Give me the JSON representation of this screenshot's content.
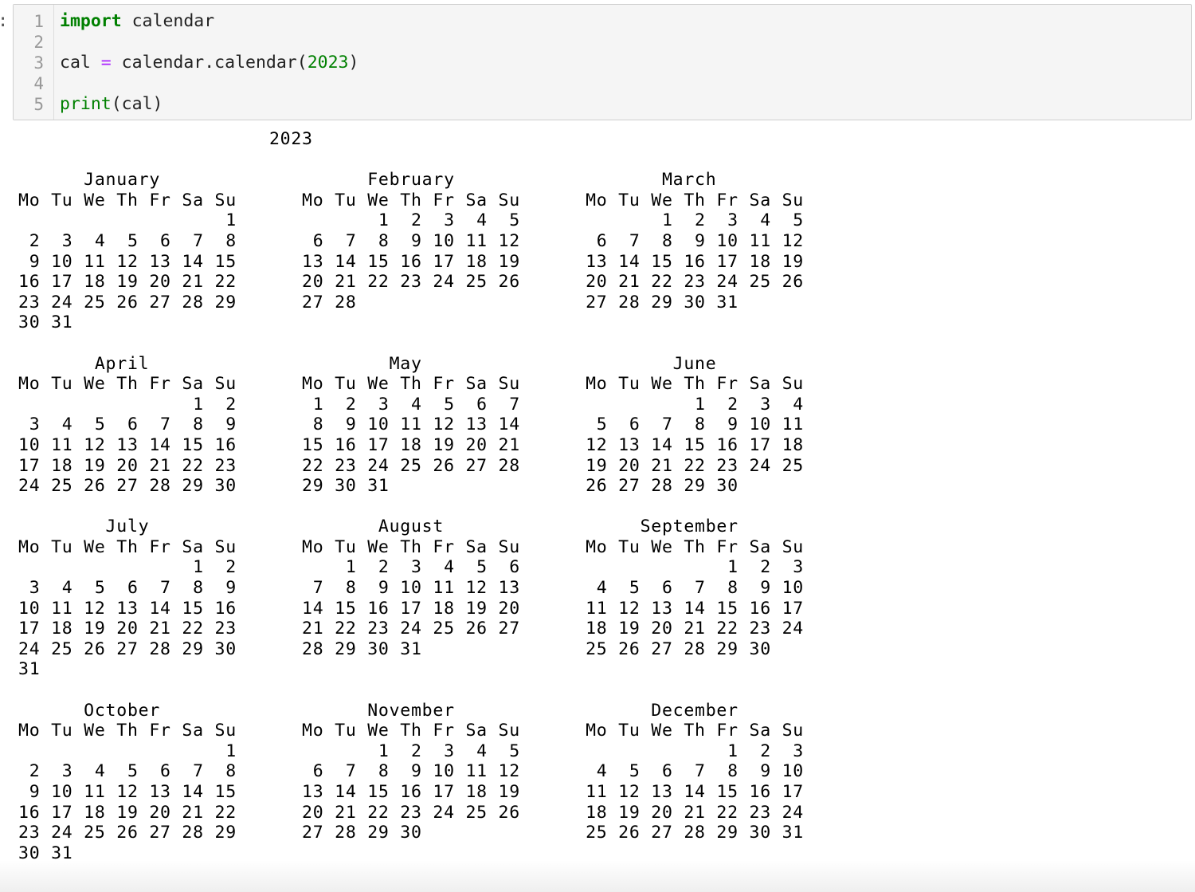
{
  "cell": {
    "prompt": ":",
    "line_numbers": [
      "1",
      "2",
      "3",
      "4",
      "5"
    ],
    "code": {
      "line1_keyword": "import",
      "line1_rest": " calendar",
      "line3_prefix": "cal ",
      "line3_op": "=",
      "line3_call": " calendar.calendar(",
      "line3_arg": "2023",
      "line3_close": ")",
      "line5_builtin": "print",
      "line5_rest": "(cal)"
    }
  },
  "output": {
    "text": "                       2023\n\n      January                   February                   March\nMo Tu We Th Fr Sa Su      Mo Tu We Th Fr Sa Su      Mo Tu We Th Fr Sa Su\n                   1             1  2  3  4  5             1  2  3  4  5\n 2  3  4  5  6  7  8       6  7  8  9 10 11 12       6  7  8  9 10 11 12\n 9 10 11 12 13 14 15      13 14 15 16 17 18 19      13 14 15 16 17 18 19\n16 17 18 19 20 21 22      20 21 22 23 24 25 26      20 21 22 23 24 25 26\n23 24 25 26 27 28 29      27 28                     27 28 29 30 31\n30 31\n\n       April                      May                       June\nMo Tu We Th Fr Sa Su      Mo Tu We Th Fr Sa Su      Mo Tu We Th Fr Sa Su\n                1  2       1  2  3  4  5  6  7                1  2  3  4\n 3  4  5  6  7  8  9       8  9 10 11 12 13 14       5  6  7  8  9 10 11\n10 11 12 13 14 15 16      15 16 17 18 19 20 21      12 13 14 15 16 17 18\n17 18 19 20 21 22 23      22 23 24 25 26 27 28      19 20 21 22 23 24 25\n24 25 26 27 28 29 30      29 30 31                  26 27 28 29 30\n\n        July                     August                  September\nMo Tu We Th Fr Sa Su      Mo Tu We Th Fr Sa Su      Mo Tu We Th Fr Sa Su\n                1  2          1  2  3  4  5  6                   1  2  3\n 3  4  5  6  7  8  9       7  8  9 10 11 12 13       4  5  6  7  8  9 10\n10 11 12 13 14 15 16      14 15 16 17 18 19 20      11 12 13 14 15 16 17\n17 18 19 20 21 22 23      21 22 23 24 25 26 27      18 19 20 21 22 23 24\n24 25 26 27 28 29 30      28 29 30 31               25 26 27 28 29 30\n31\n\n      October                   November                  December\nMo Tu We Th Fr Sa Su      Mo Tu We Th Fr Sa Su      Mo Tu We Th Fr Sa Su\n                   1             1  2  3  4  5                   1  2  3\n 2  3  4  5  6  7  8       6  7  8  9 10 11 12       4  5  6  7  8  9 10\n 9 10 11 12 13 14 15      13 14 15 16 17 18 19      11 12 13 14 15 16 17\n16 17 18 19 20 21 22      20 21 22 23 24 25 26      18 19 20 21 22 23 24\n23 24 25 26 27 28 29      27 28 29 30               25 26 27 28 29 30 31\n30 31"
  },
  "colors": {
    "cell_background": "#f5f5f5",
    "cell_border": "#cfcfcf",
    "keyword": "#008000",
    "operator": "#aa22ff",
    "line_number": "#999999"
  }
}
